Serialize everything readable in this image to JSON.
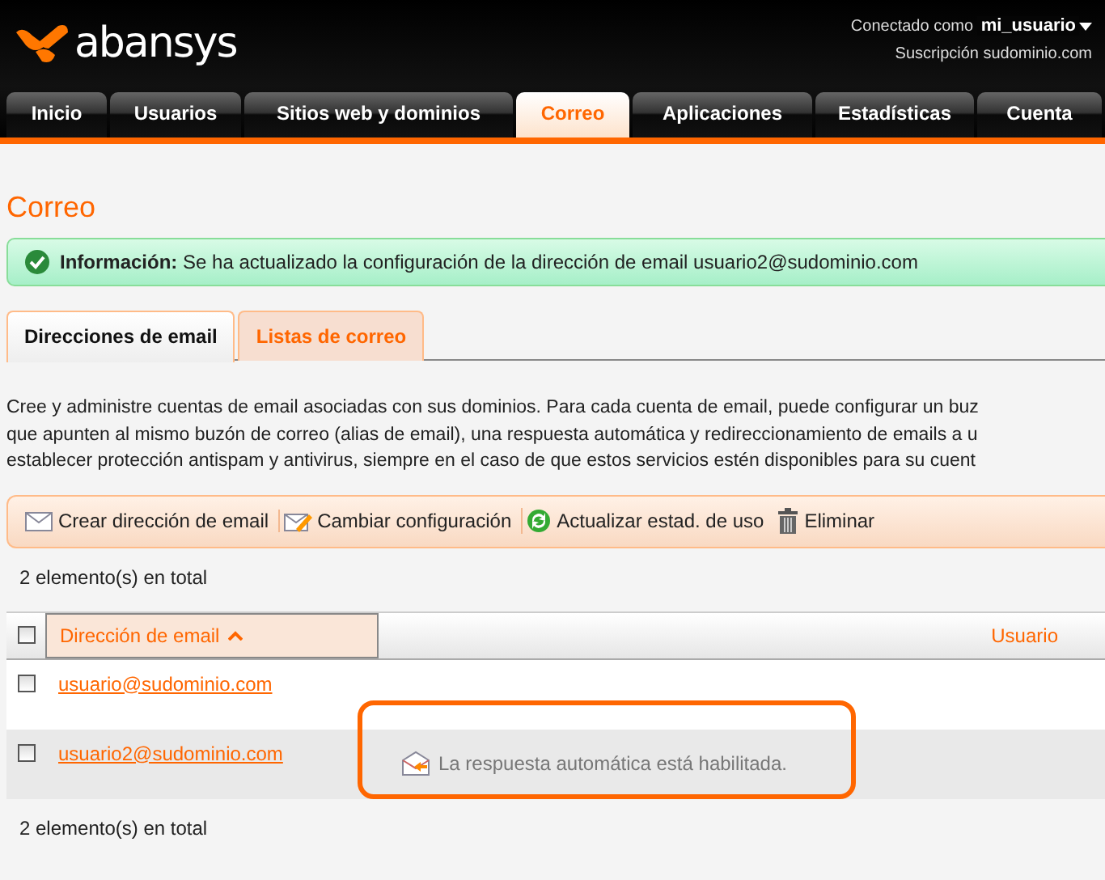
{
  "header": {
    "logo": "abansys",
    "connected_label": "Conectado como",
    "user": "mi_usuario",
    "subscription": "Suscripción sudominio.com"
  },
  "nav": [
    {
      "label": "Inicio",
      "selected": false
    },
    {
      "label": "Usuarios",
      "selected": false
    },
    {
      "label": "Sitios web y dominios",
      "selected": false
    },
    {
      "label": "Correo",
      "selected": true
    },
    {
      "label": "Aplicaciones",
      "selected": false
    },
    {
      "label": "Estadísticas",
      "selected": false
    },
    {
      "label": "Cuenta",
      "selected": false
    }
  ],
  "page_title": "Correo",
  "message": {
    "label": "Información:",
    "text": "Se ha actualizado la configuración de la dirección de email  usuario2@sudominio.com"
  },
  "tabs": [
    {
      "label": "Direcciones de email",
      "selected": true
    },
    {
      "label": "Listas de correo",
      "selected": false
    }
  ],
  "description": [
    "Cree y administre cuentas de email asociadas con sus dominios. Para cada cuenta de email, puede configurar un buz",
    "que apunten al mismo buzón de correo (alias de email), una respuesta automática y redireccionamiento de emails a u",
    "establecer protección antispam y antivirus, siempre en el caso de que estos servicios estén disponibles para su cuent"
  ],
  "toolbar": [
    {
      "kind": "create",
      "label": "Crear dirección de email"
    },
    {
      "kind": "edit",
      "label": "Cambiar configuración"
    },
    {
      "kind": "refresh",
      "label": "Actualizar estad. de uso"
    },
    {
      "kind": "delete",
      "label": "Eliminar"
    }
  ],
  "count_top": "2 elemento(s) en total",
  "table": {
    "select_all_checked": false,
    "columns": [
      {
        "label": "Dirección de email",
        "sorted": true
      },
      {
        "label": "Usuario",
        "sorted": false
      }
    ],
    "rows": [
      {
        "address": "usuario@sudominio.com",
        "checked": false
      },
      {
        "address": "usuario2@sudominio.com",
        "checked": false,
        "note": "La respuesta automática está habilitada."
      }
    ]
  },
  "count_bottom": "2 elemento(s) en total"
}
